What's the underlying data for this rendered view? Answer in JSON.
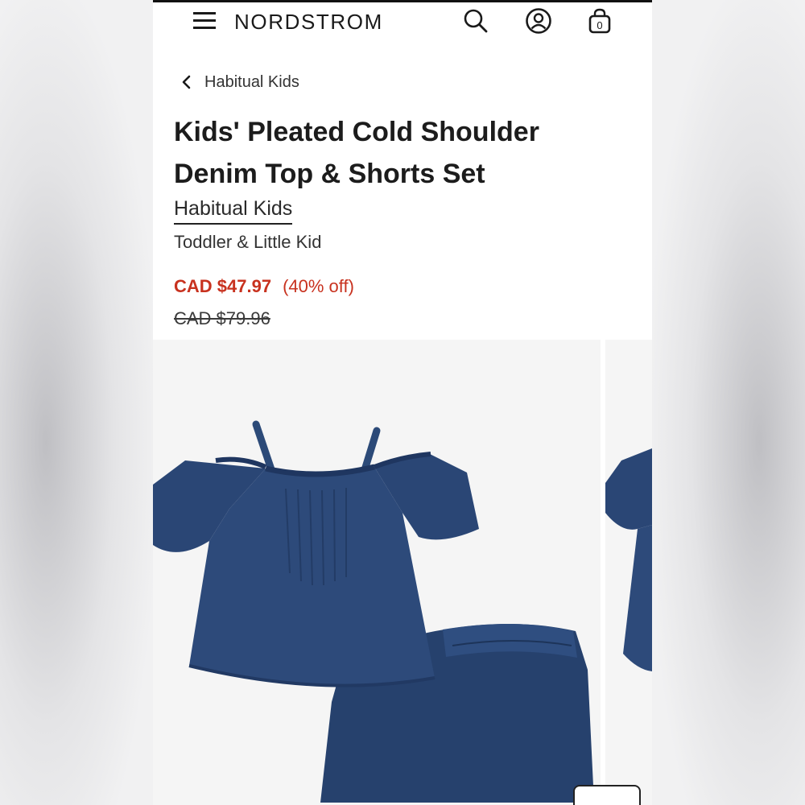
{
  "header": {
    "logo": "NORDSTROM",
    "menu_icon": "hamburger-menu-icon",
    "search_icon": "search-icon",
    "account_icon": "account-icon",
    "bag_icon": "shopping-bag-icon",
    "bag_count": "0"
  },
  "breadcrumb": {
    "label": "Habitual Kids",
    "icon": "chevron-left-icon"
  },
  "product": {
    "title": "Kids' Pleated Cold Shoulder Denim Top & Shorts Set",
    "brand": "Habitual Kids",
    "sizing": "Toddler & Little Kid",
    "sale_price": "CAD $47.97",
    "discount": "(40% off)",
    "original_price": "CAD $79.96"
  },
  "colors": {
    "sale": "#c8321f",
    "denim": "#2f4f7f",
    "text": "#1c1c1c"
  },
  "gallery": {
    "main_image": "denim-top-shorts-set-photo",
    "next_image": "denim-top-partial-photo"
  }
}
